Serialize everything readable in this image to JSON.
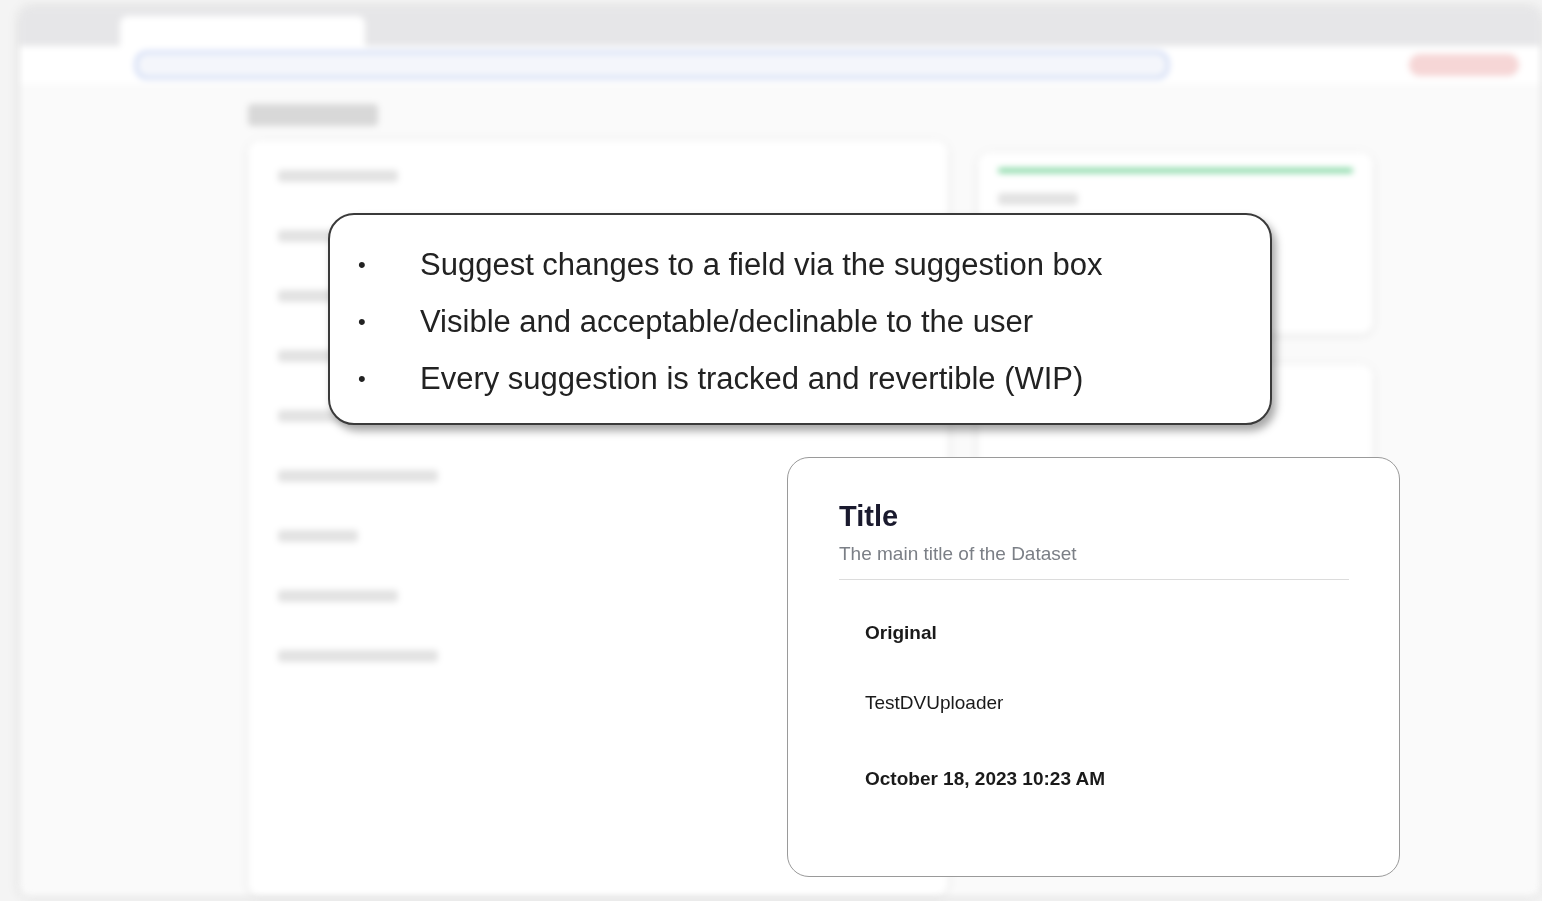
{
  "callout": {
    "bullets": [
      {
        "marker": "•",
        "text": "Suggest changes to a field via the suggestion box"
      },
      {
        "marker": "•",
        "text": "Visible and acceptable/declinable to the user"
      },
      {
        "marker": "•",
        "text": "Every suggestion is tracked and revertible (WIP)"
      }
    ]
  },
  "suggestion_card": {
    "title": "Title",
    "subtitle": "The main title of the Dataset",
    "section_label": "Original",
    "value": "TestDVUploader",
    "timestamp": "October 18, 2023 10:23 AM"
  }
}
